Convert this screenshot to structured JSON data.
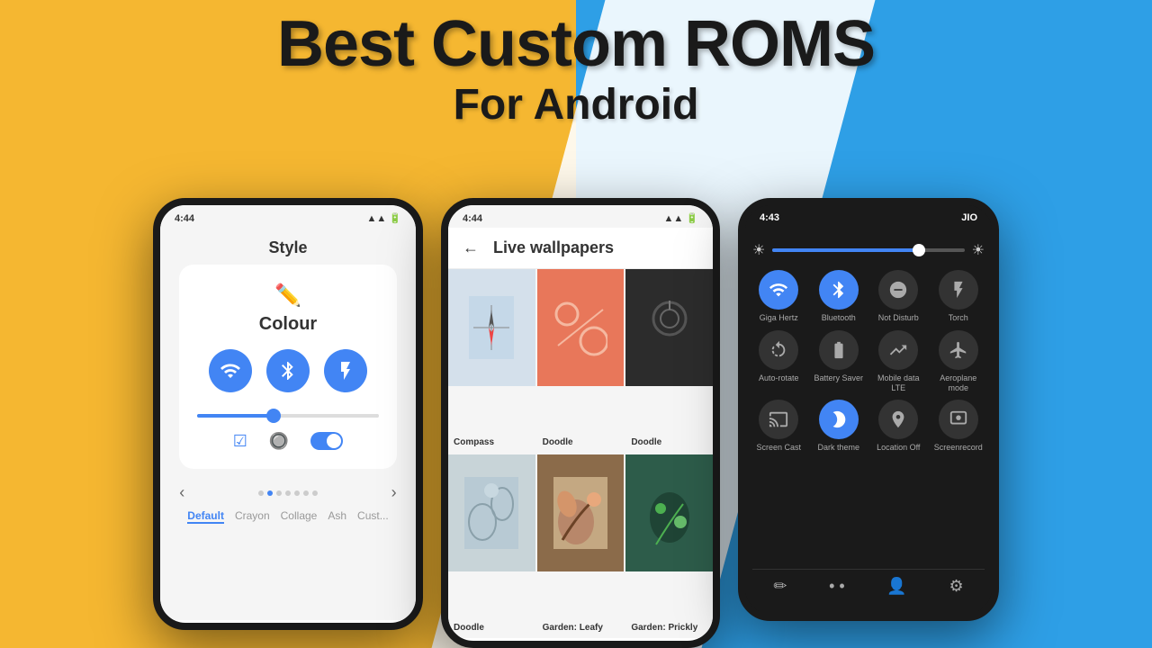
{
  "background": {
    "yellow": "#F5B731",
    "blue": "#2E9FE6",
    "white": "#FFFFFF"
  },
  "title": {
    "main": "Best Custom ROMS",
    "sub": "For Android"
  },
  "phone_left": {
    "status_time": "4:44",
    "screen_title": "Style",
    "colour_label": "Colour",
    "tabs": [
      "Default",
      "Crayon",
      "Collage",
      "Ash",
      "Cust..."
    ]
  },
  "phone_center": {
    "status_time": "4:44",
    "header_title": "Live wallpapers",
    "back_label": "←",
    "wallpapers": [
      {
        "name": "Compass",
        "style": "compass"
      },
      {
        "name": "Doodle",
        "style": "doodle1"
      },
      {
        "name": "Doodle",
        "style": "doodle2"
      },
      {
        "name": "Doodle",
        "style": "doodle3"
      },
      {
        "name": "Garden: Leafy",
        "style": "garden1"
      },
      {
        "name": "Garden: Prickly",
        "style": "garden2"
      }
    ]
  },
  "phone_right": {
    "status_time": "4:43",
    "carrier": "JIO",
    "tiles": [
      {
        "label": "Giga Hertz",
        "icon": "wifi",
        "active": true
      },
      {
        "label": "Bluetooth",
        "icon": "bluetooth",
        "active": true
      },
      {
        "label": "Not Disturb",
        "icon": "minus-circle",
        "active": false
      },
      {
        "label": "Torch",
        "icon": "flashlight",
        "active": false
      },
      {
        "label": "Auto-rotate",
        "icon": "rotate",
        "active": false
      },
      {
        "label": "Battery Saver",
        "icon": "battery",
        "active": false
      },
      {
        "label": "Mobile data LTE",
        "icon": "signal",
        "active": false
      },
      {
        "label": "Aeroplane mode",
        "icon": "plane",
        "active": false
      },
      {
        "label": "Screen Cast",
        "icon": "cast",
        "active": false
      },
      {
        "label": "Dark theme",
        "icon": "moon",
        "active": true
      },
      {
        "label": "Location Off",
        "icon": "location",
        "active": false
      },
      {
        "label": "Screenrecord",
        "icon": "record",
        "active": false
      }
    ]
  }
}
